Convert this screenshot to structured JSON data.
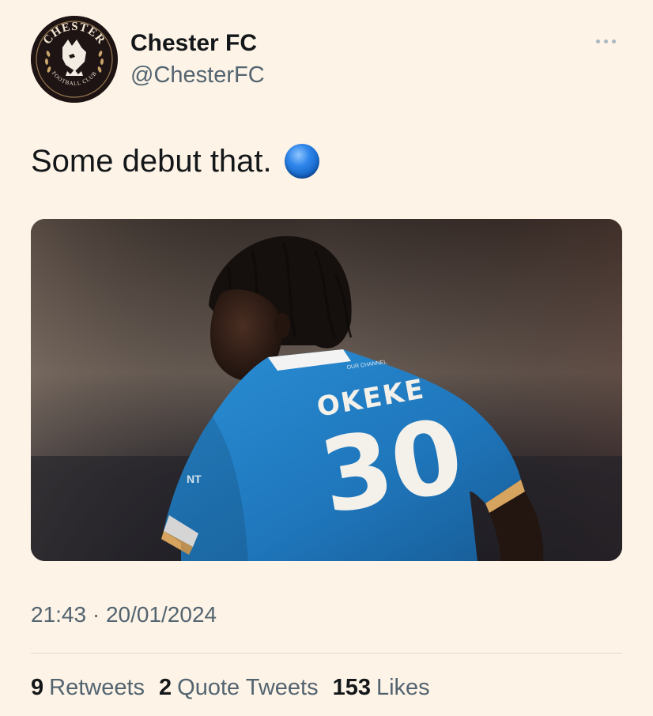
{
  "account": {
    "display_name": "Chester FC",
    "handle": "@ChesterFC",
    "avatar_icon": "chester-fc-crest-icon",
    "crest_text_top": "CHESTER",
    "crest_text_bottom": "FOOTBALL CLUB"
  },
  "tweet": {
    "text": "Some debut that.",
    "emoji": "blue-circle-emoji",
    "timestamp": "21:43 · 20/01/2024"
  },
  "media": {
    "jersey_name": "OKEKE",
    "jersey_number": "30"
  },
  "stats": {
    "retweets_count": "9",
    "retweets_label": "Retweets",
    "quotes_count": "2",
    "quotes_label": "Quote Tweets",
    "likes_count": "153",
    "likes_label": "Likes"
  },
  "colors": {
    "background": "#fdf3e6",
    "text_primary": "#14171a",
    "text_secondary": "#536471",
    "jersey_blue": "#1f7fc4"
  }
}
